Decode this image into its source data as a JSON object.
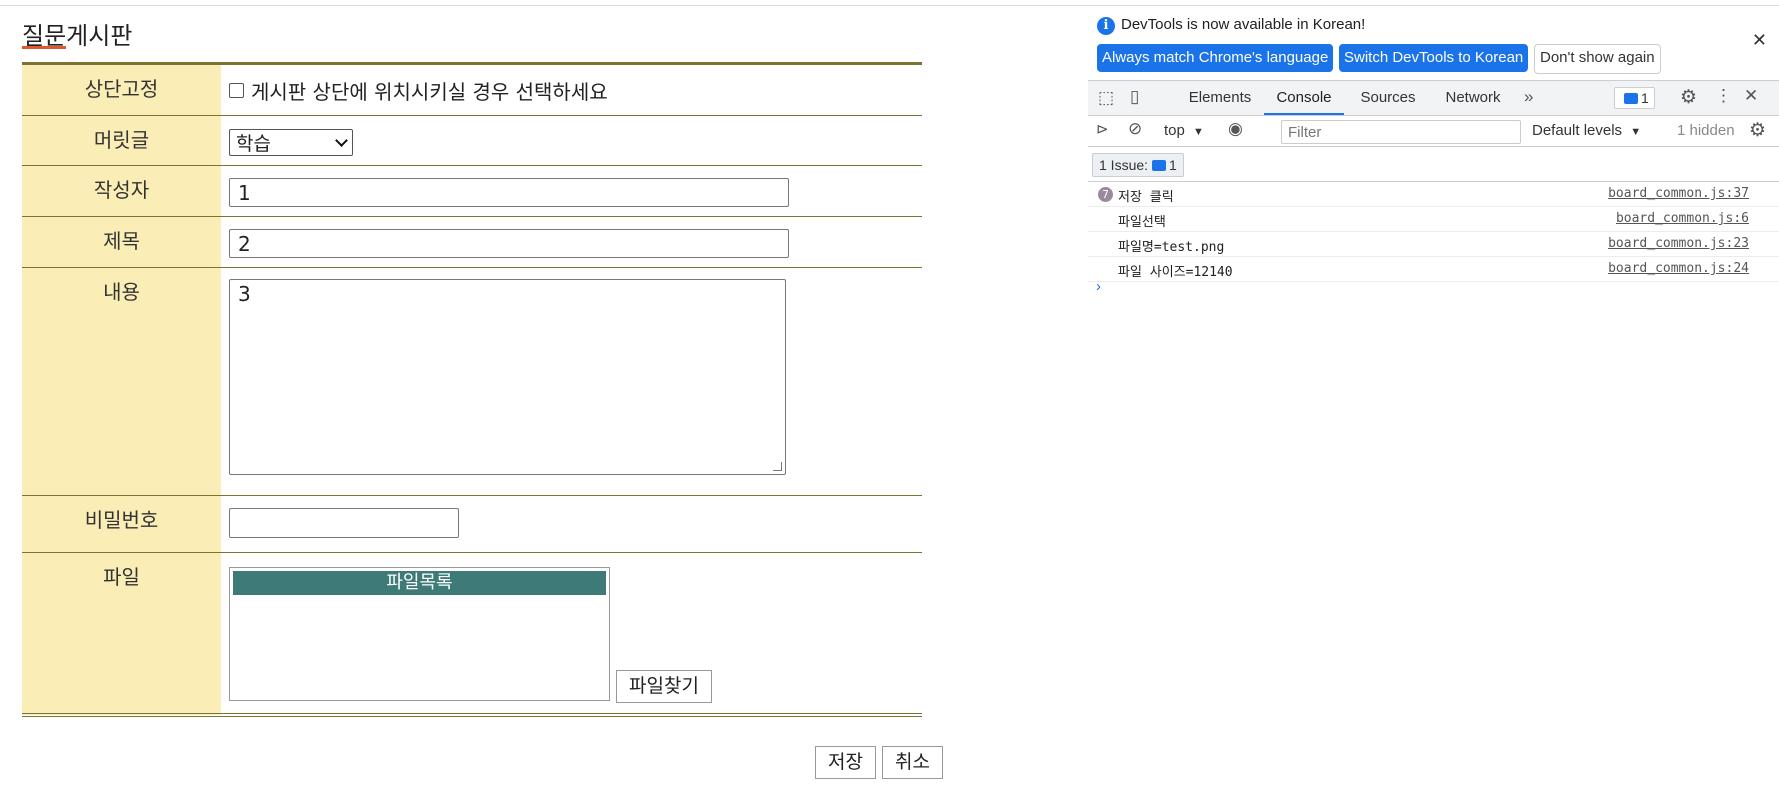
{
  "board": {
    "title": "질문게시판",
    "fields": {
      "pin_label": "상단고정",
      "pin_text": "게시판 상단에 위치시키실 경우 선택하세요",
      "category_label": "머릿글",
      "category_value": "학습",
      "author_label": "작성자",
      "author_value": "1",
      "subject_label": "제목",
      "subject_value": "2",
      "content_label": "내용",
      "content_value": "3",
      "password_label": "비밀번호",
      "password_value": "",
      "file_label": "파일",
      "file_list_header": "파일목록",
      "file_find_button": "파일찾기"
    },
    "save_button": "저장",
    "cancel_button": "취소",
    "accent_color": "#e2572d",
    "label_bg": "#faedb5",
    "border_color": "#7a7430"
  },
  "devtools": {
    "infobar": {
      "message": "DevTools is now available in Korean!",
      "btn_match": "Always match Chrome's language",
      "btn_switch": "Switch DevTools to Korean",
      "btn_dont_show": "Don't show again"
    },
    "tabs": [
      "Elements",
      "Console",
      "Sources",
      "Network"
    ],
    "active_tab": "Console",
    "issues_badge": "1",
    "toolbar": {
      "context": "top",
      "filter_placeholder": "Filter",
      "levels": "Default levels",
      "hidden": "1 hidden"
    },
    "issues_chip": {
      "label": "1 Issue:",
      "count": "1"
    },
    "console": [
      {
        "count": "7",
        "text": "저장 클릭",
        "source": "board_common.js:37"
      },
      {
        "count": "",
        "text": "파일선택",
        "source": "board_common.js:6"
      },
      {
        "count": "",
        "text": "파일명=test.png",
        "source": "board_common.js:23"
      },
      {
        "count": "",
        "text": "파일 사이즈=12140",
        "source": "board_common.js:24"
      }
    ],
    "accent_color": "#1a73e8"
  }
}
